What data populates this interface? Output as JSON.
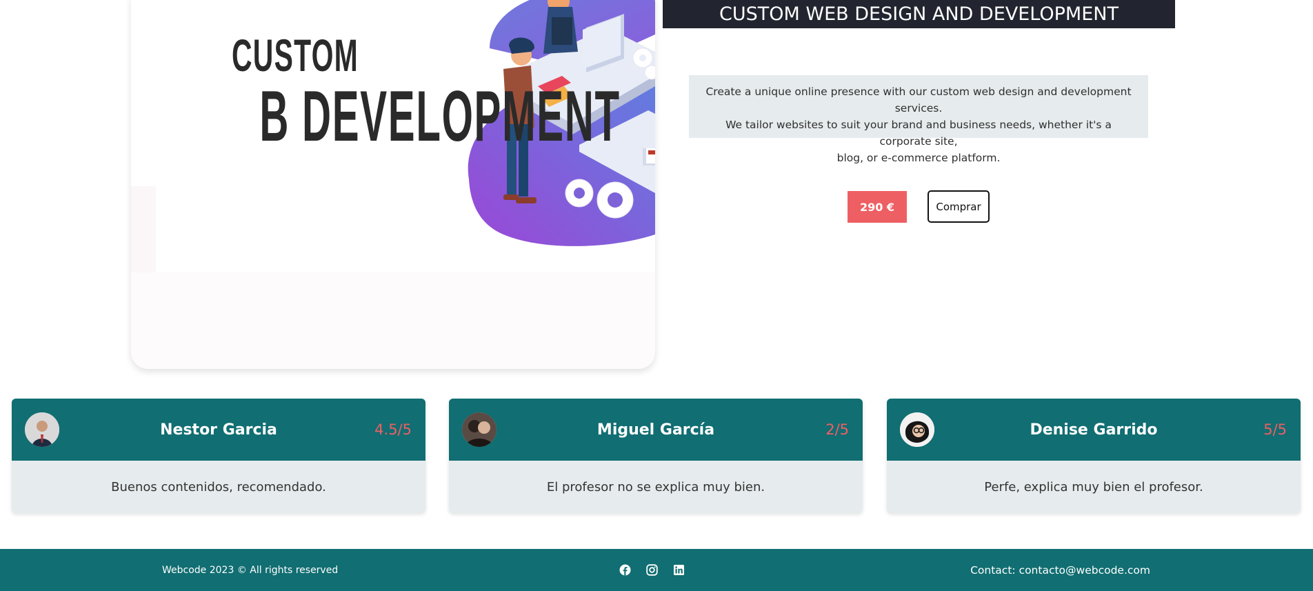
{
  "product": {
    "image_text_line1": "CUSTOM",
    "image_text_line2": "B DEVELOPMENT",
    "title": "CUSTOM WEB DESIGN AND DEVELOPMENT",
    "description_lines": [
      "Create a unique online presence with our custom web design and development services.",
      "We tailor websites to suit your brand and business needs, whether it's a corporate site,",
      "blog, or e-commerce platform."
    ],
    "price": "290 €",
    "buy_label": "Comprar"
  },
  "reviews": [
    {
      "name": "Nestor Garcia",
      "rating": "4.5/5",
      "comment": "Buenos contenidos, recomendado."
    },
    {
      "name": "Miguel García",
      "rating": "2/5",
      "comment": "El profesor no se explica muy bien."
    },
    {
      "name": "Denise Garrido",
      "rating": "5/5",
      "comment": "Perfe, explica muy bien el profesor."
    }
  ],
  "footer": {
    "copyright": "Webcode 2023 © All rights reserved",
    "social": [
      "facebook-icon",
      "instagram-icon",
      "linkedin-icon"
    ],
    "contact": "Contact: contacto@webcode.com"
  },
  "colors": {
    "teal": "#116e72",
    "accent_red": "#ee5f63",
    "title_bar": "#22252f",
    "card_bg": "#e6ebed"
  }
}
